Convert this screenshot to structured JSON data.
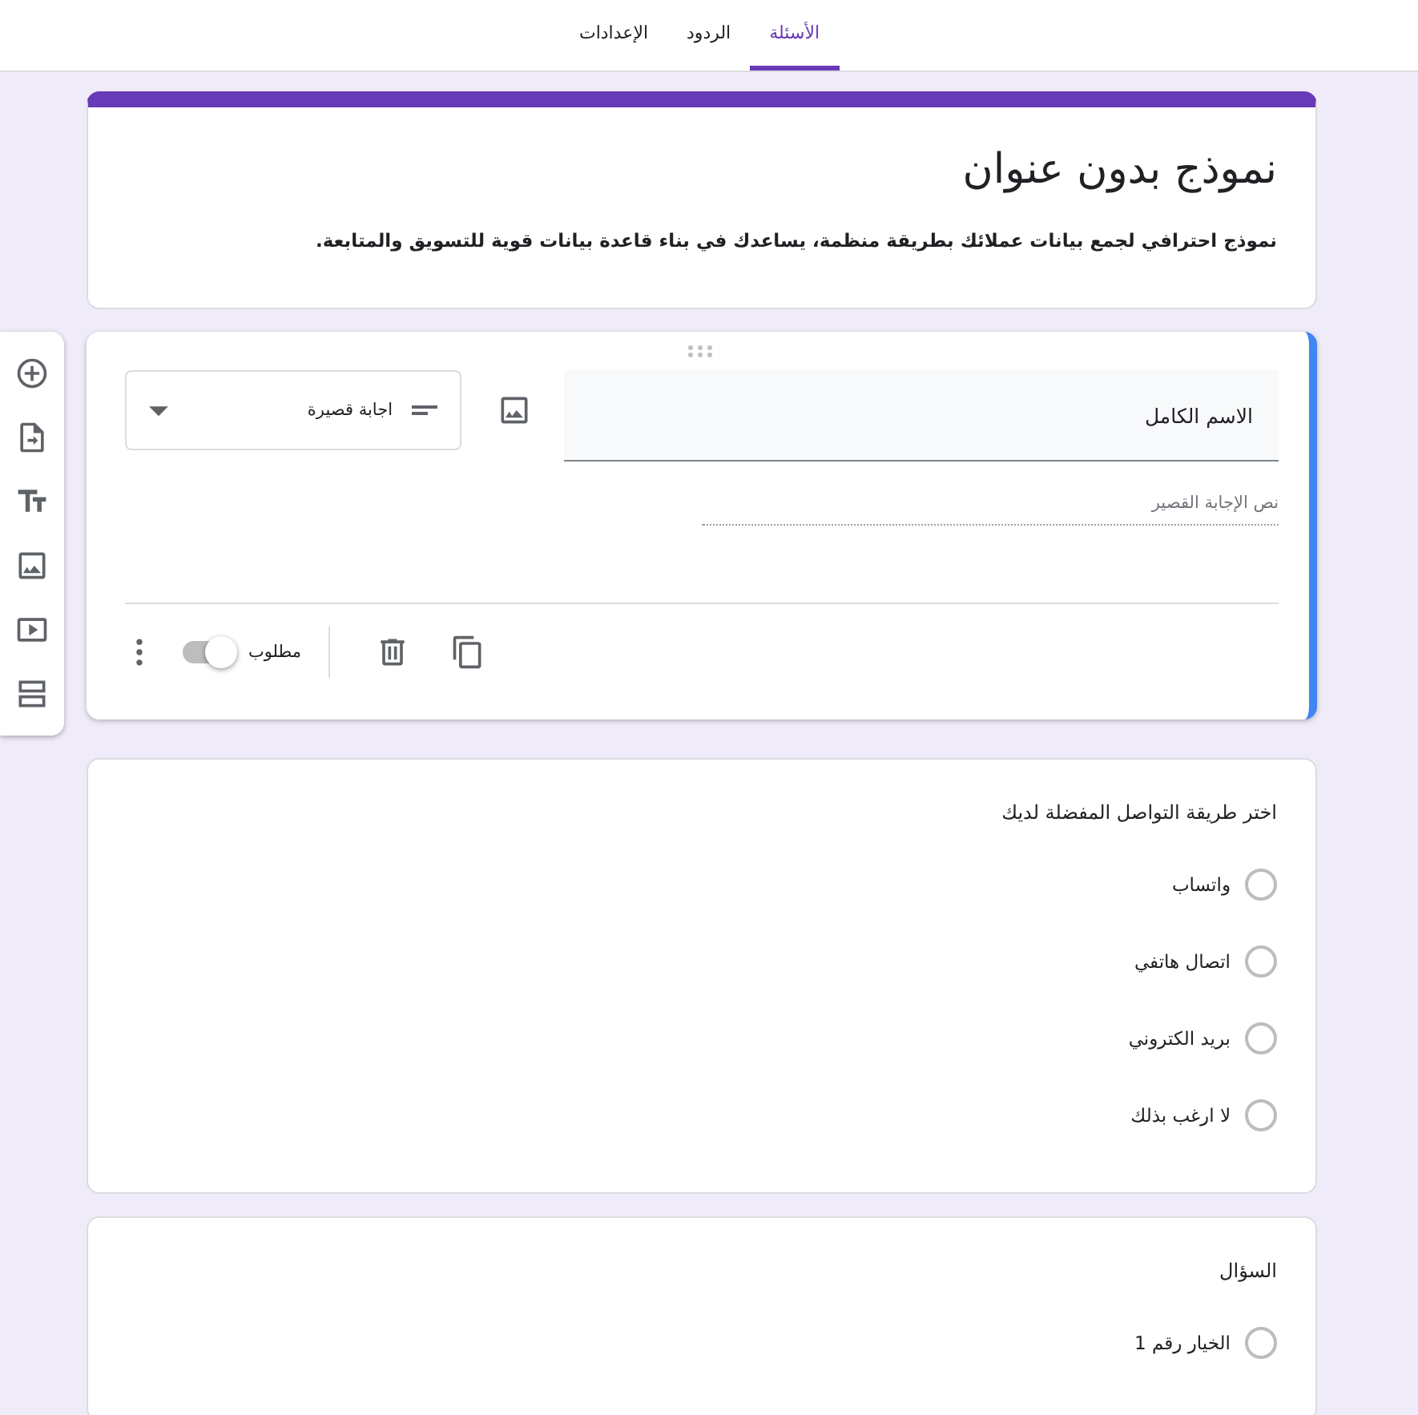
{
  "tabs": [
    {
      "label": "الأسئلة",
      "selected": true
    },
    {
      "label": "الردود",
      "selected": false
    },
    {
      "label": "الإعدادات",
      "selected": false
    }
  ],
  "form_header": {
    "title": "نموذج بدون عنوان",
    "description": "نموذج احترافي لجمع بيانات عملائك بطريقة منظمة، يساعدك في بناء قاعدة بيانات قوية للتسويق والمتابعة."
  },
  "active_question": {
    "title": "الاسم الكامل",
    "question_type": "اجابة قصيرة",
    "answer_placeholder": "نص الإجابة القصير",
    "required_label": "مطلوب",
    "required": false
  },
  "questions": [
    {
      "title": "اختر طريقة التواصل المفضلة لديك",
      "options": [
        {
          "label": "واتساب",
          "selected": false
        },
        {
          "label": "اتصال هاتفي",
          "selected": false
        },
        {
          "label": "بريد الكتروني",
          "selected": false
        },
        {
          "label": "لا ارغب بذلك",
          "selected": false
        }
      ]
    },
    {
      "title": "السؤال",
      "options": [
        {
          "label": "الخيار رقم 1",
          "selected": false
        }
      ]
    }
  ]
}
